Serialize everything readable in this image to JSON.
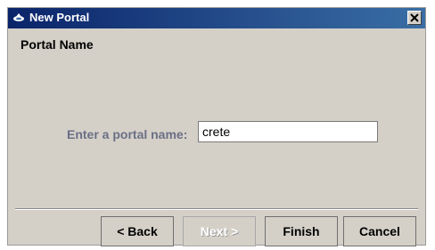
{
  "window": {
    "title": "New Portal",
    "close_glyph": "✕",
    "title_icon": "portal-icon"
  },
  "page": {
    "heading": "Portal Name",
    "prompt_label": "Enter a portal name:",
    "portal_name_value": "crete"
  },
  "buttons": {
    "back": "< Back",
    "next": "Next >",
    "finish": "Finish",
    "cancel": "Cancel"
  },
  "colors": {
    "titlebar_start": "#0a246a",
    "titlebar_end": "#3a6ea5",
    "dialog_bg": "#d4d0c8",
    "prompt_label": "#6b6f86"
  }
}
